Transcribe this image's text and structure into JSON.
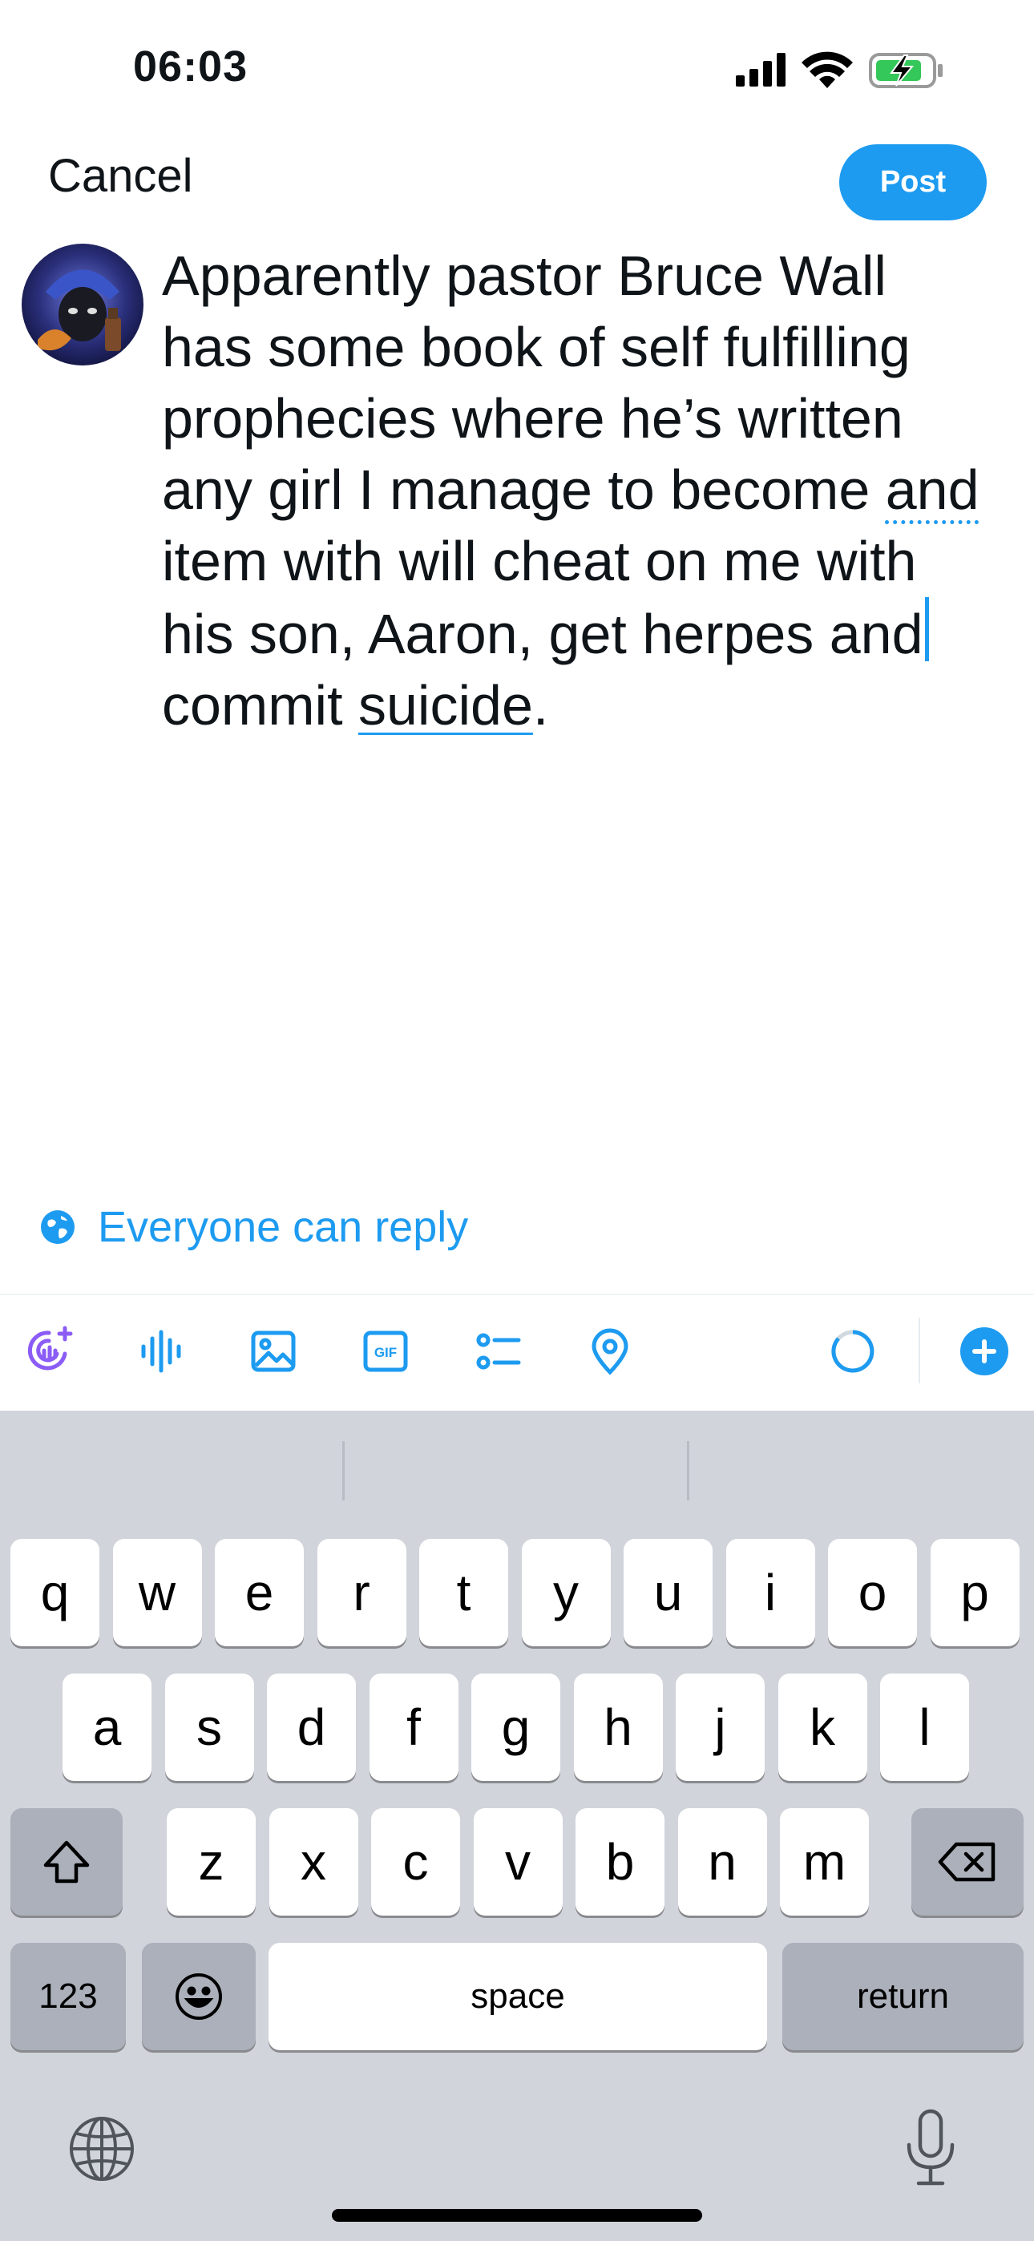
{
  "status_bar": {
    "time": "06:03"
  },
  "nav": {
    "cancel_label": "Cancel",
    "post_label": "Post"
  },
  "compose": {
    "text_segments": [
      "Apparently pastor Bruce Wall\nhas some book of self fulfilling\nprophecies where he’s written\nany girl I manage to become ",
      "and",
      "\nitem with will cheat on me with\nhis son, Aaron, get herpes and",
      "\ncommit ",
      "suicide",
      "."
    ]
  },
  "reply_setting": {
    "label": "Everyone can reply",
    "icon": "globe-icon"
  },
  "toolbar": {
    "icons": [
      "grok-icon",
      "voice-icon",
      "image-icon",
      "gif-icon",
      "poll-icon",
      "location-icon",
      "char-counter-icon",
      "add-post-icon"
    ],
    "gif_text": "GIF"
  },
  "keyboard": {
    "row1": [
      "q",
      "w",
      "e",
      "r",
      "t",
      "y",
      "u",
      "i",
      "o",
      "p"
    ],
    "row2": [
      "a",
      "s",
      "d",
      "f",
      "g",
      "h",
      "j",
      "k",
      "l"
    ],
    "row3": [
      "z",
      "x",
      "c",
      "v",
      "b",
      "n",
      "m"
    ],
    "numbers_label": "123",
    "space_label": "space",
    "return_label": "return"
  },
  "colors": {
    "accent": "#1d9bf0",
    "keyboard_bg": "#d1d4db",
    "key_dark": "#abb0ba"
  }
}
